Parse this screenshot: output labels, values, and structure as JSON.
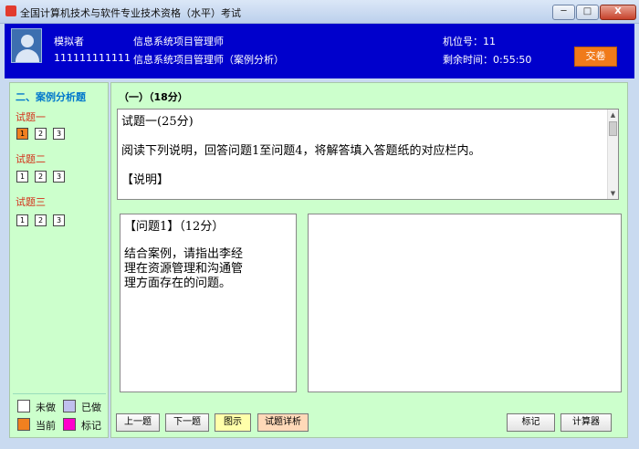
{
  "window": {
    "title": "全国计算机技术与软件专业技术资格（水平）考试",
    "minimize": "─",
    "maximize": "□",
    "close": "X"
  },
  "header": {
    "candidate_name": "模拟者",
    "candidate_id": "111111111111",
    "exam_name": "信息系统项目管理师",
    "paper_name": "信息系统项目管理师（案例分析）",
    "seat_label": "机位号：",
    "seat_value": "11",
    "time_label": "剩余时间：",
    "time_value": "0:55:50",
    "submit_label": "交卷"
  },
  "sidebar": {
    "section_title": "二、案例分析题",
    "groups": [
      {
        "label": "试题一",
        "items": [
          "1",
          "2",
          "3"
        ]
      },
      {
        "label": "试题二",
        "items": [
          "1",
          "2",
          "3"
        ]
      },
      {
        "label": "试题三",
        "items": [
          "1",
          "2",
          "3"
        ]
      }
    ],
    "legend": {
      "unanswered": "未做",
      "answered": "已做",
      "current": "当前",
      "marked": "标记"
    }
  },
  "main": {
    "part_title": "（一）（18分）",
    "question_header": "试题一(25分)",
    "intro_text": "阅读下列说明，回答问题1至问题4，将解答填入答题纸的对应栏内。",
    "section_label": "【说明】",
    "subq_title": "【问题1】（12分）",
    "subq_lines": [
      "结合案例，请指出李经",
      "理在资源管理和沟通管",
      "理方面存在的问题。"
    ]
  },
  "buttons": {
    "prev": "上一题",
    "next": "下一题",
    "figure": "图示",
    "review": "试题详析",
    "mark": "标记",
    "calculator": "计算器"
  },
  "colors": {
    "header_bg": "#0000cc",
    "panel_bg": "#ccffcc",
    "submit_bg": "#f07a1a",
    "current_color": "#f08020",
    "answered_color": "#c0c0ee",
    "marked_color": "#ff00cc"
  }
}
